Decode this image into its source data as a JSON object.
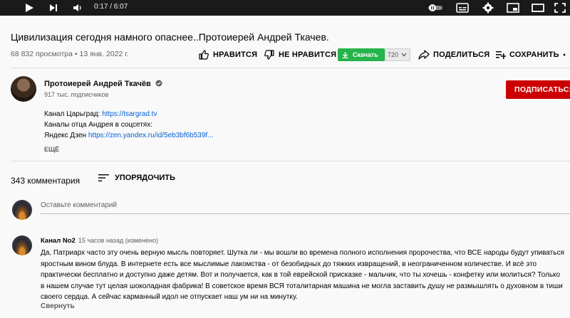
{
  "player": {
    "time": "0:17 / 6:07",
    "controls": [
      "play-icon",
      "next-icon",
      "volume-icon",
      "autoplay-toggle-icon",
      "subtitles-icon",
      "settings-icon",
      "miniplayer-icon",
      "theater-icon",
      "fullscreen-icon"
    ]
  },
  "video": {
    "title": "Цивилизация сегодня намного опаснее..Протоиерей Андрей Ткачев.",
    "views_date": "68 832 просмотра • 13 янв. 2022 г."
  },
  "actions": {
    "like": "НРАВИТСЯ",
    "dislike": "НЕ НРАВИТСЯ",
    "download": "Скачать",
    "quality": "720",
    "share": "ПОДЕЛИТЬСЯ",
    "save": "СОХРАНИТЬ"
  },
  "channel": {
    "name": "Протоиерей Андрей Ткачёв",
    "subscribers": "917 тыс. подписчиков",
    "subscribe_label": "ПОДПИСАТЬСЯ"
  },
  "description": {
    "line1_label": "Канал Царьград: ",
    "line1_link": "https://tsargrad.tv",
    "line2": "Каналы отца Андрея в соцсетях:",
    "line3_label": "Яндекс Дзен ",
    "line3_link": "https://zen.yandex.ru/id/5eb3bf6b539f...",
    "more": "ЕЩЁ"
  },
  "comments": {
    "count": "343 комментария",
    "sort_label": "УПОРЯДОЧИТЬ",
    "add_placeholder": "Оставьте комментарий",
    "items": [
      {
        "author": "Канал No2",
        "meta": "15 часов назад (изменено)",
        "text": "Да, Патриарх часто эту очень верную мысль повторяет. Шутка ли - мы вошли во времена полного исполнения пророчества, что ВСЕ народы будут упиваться яростным вином блуда. В интернете есть все мыслимые лакомства - от безобидных до тяжких извращений, в неограниченном количестве. И всё это практически бесплатно и доступно даже детям. Вот и получается, как в той еврейской присказке - мальчик, что ты хочешь - конфетку или молиться? Только в нашем случае тут целая шоколадная фабрика! В советское время ВСЯ тоталитарная машина не могла заставить душу не размышлять о духовном в тиши своего сердца. А сейчас карманный идол не отпускает наш ум ни на минутку.",
        "collapse": "Свернуть"
      }
    ]
  },
  "colors": {
    "subscribe": "#cc0000",
    "download": "#25b34c",
    "link": "#065fd4"
  }
}
